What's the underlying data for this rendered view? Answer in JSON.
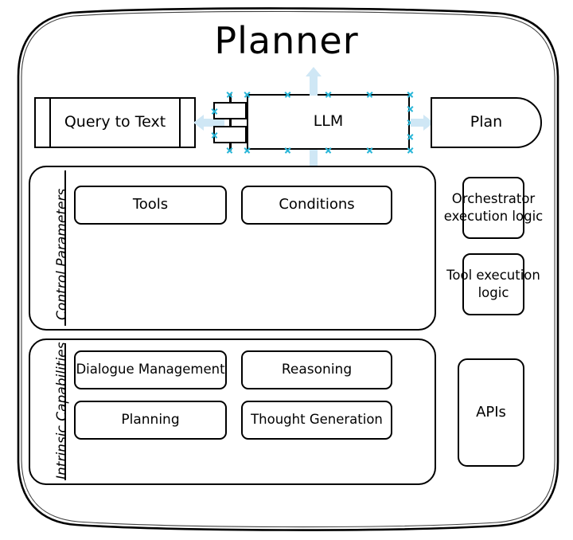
{
  "diagram": {
    "title": "Planner",
    "type": "architecture-block-diagram",
    "top_row": {
      "query_to_text": {
        "label": "Query to Text",
        "shape": "predefined-process"
      },
      "mini_process_chain": {
        "boxes": 2,
        "shape": "stacked-rectangles"
      },
      "llm": {
        "label": "LLM",
        "shape": "rectangle",
        "selected": true
      },
      "plan": {
        "label": "Plan",
        "shape": "terminator"
      }
    },
    "groups": [
      {
        "label": "Control Parameters",
        "items": [
          {
            "label": "Tools"
          },
          {
            "label": "Conditions"
          }
        ]
      },
      {
        "label": "Intrinsic Capabilities",
        "items": [
          {
            "label": "Dialogue Management"
          },
          {
            "label": "Reasoning"
          },
          {
            "label": "Planning"
          },
          {
            "label": "Thought Generation"
          }
        ]
      }
    ],
    "right_column": [
      {
        "label": "Orchestrator execution logic"
      },
      {
        "label": "Tool execution logic"
      },
      {
        "label": "APIs"
      }
    ],
    "arrows": [
      {
        "name": "llm-to-query-to-text",
        "direction": "left"
      },
      {
        "name": "llm-to-plan",
        "direction": "right"
      },
      {
        "name": "llm-up",
        "direction": "up"
      },
      {
        "name": "llm-down",
        "direction": "down"
      }
    ],
    "colors": {
      "stroke": "#000000",
      "background": "#ffffff",
      "arrow": "#cfe7f5",
      "selection_handle": "#29b6d8"
    }
  }
}
